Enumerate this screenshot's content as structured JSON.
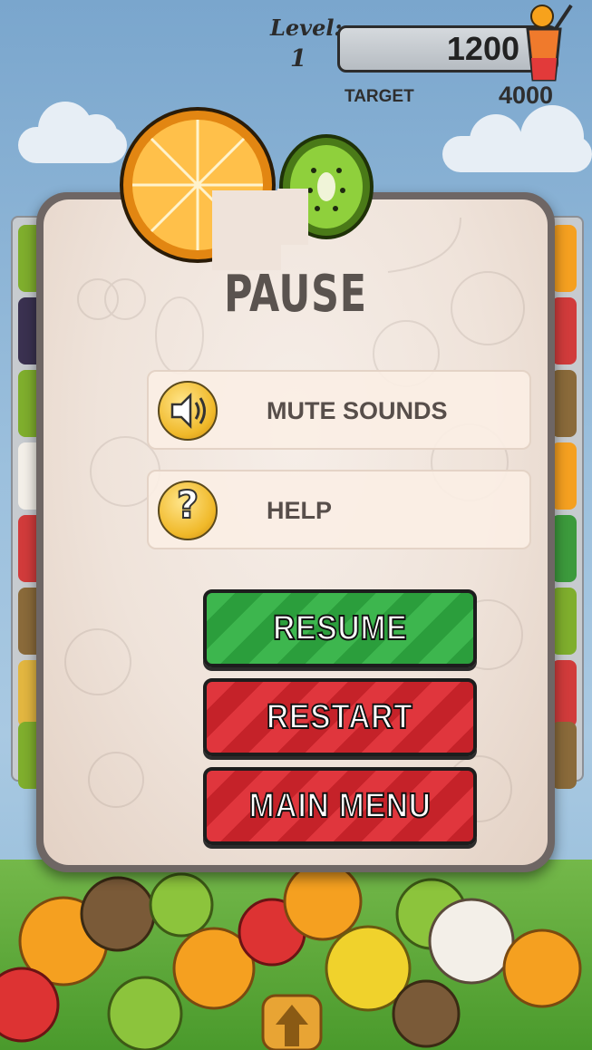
{
  "hud": {
    "level_label": "Level:",
    "level_value": "1",
    "score": "1200",
    "target_label": "TARGET",
    "target_value": "4000"
  },
  "pause_menu": {
    "title": "PAUSE",
    "options": [
      {
        "label": "MUTE SOUNDS",
        "icon": "speaker-icon"
      },
      {
        "label": "HELP",
        "icon": "question-icon"
      }
    ],
    "buttons": [
      {
        "label": "RESUME",
        "color": "#3db64e"
      },
      {
        "label": "RESTART",
        "color": "#e0363d"
      },
      {
        "label": "MAIN MENU",
        "color": "#e0363d"
      }
    ]
  },
  "colors": {
    "panel_border": "#6e6664",
    "panel_fill": "#efe3da",
    "text_dark": "#574e4a"
  }
}
